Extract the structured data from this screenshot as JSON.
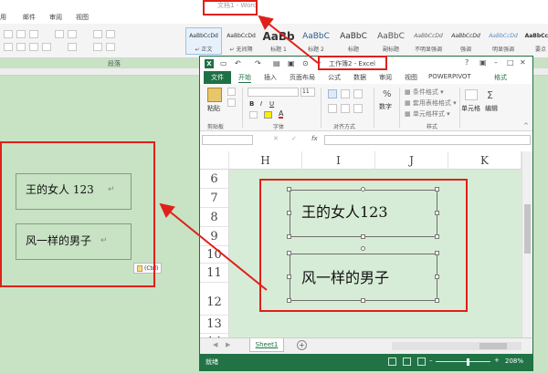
{
  "word": {
    "title": "文档1 - Word",
    "tabs": [
      "用",
      "邮件",
      "审阅",
      "视图"
    ],
    "styles": [
      {
        "sample": "AaBbCcDd",
        "name": "↵ 正文",
        "selected": true
      },
      {
        "sample": "AaBbCcDd",
        "name": "↵ 无间隔"
      },
      {
        "sample": "AaBb",
        "name": "标题 1"
      },
      {
        "sample": "AaBbC",
        "name": "标题 2"
      },
      {
        "sample": "AaBbC",
        "name": "标题"
      },
      {
        "sample": "AaBbC",
        "name": "副标题"
      },
      {
        "sample": "AaBbCcDd",
        "name": "不明显强调"
      },
      {
        "sample": "AaBbCcDd",
        "name": "强调"
      },
      {
        "sample": "AaBbCcDd",
        "name": "明显强调"
      },
      {
        "sample": "AaBbCcDd",
        "name": "要点"
      }
    ],
    "group_paragraph": "段落",
    "textbox1": "王的女人 123",
    "textbox2": "风一样的男子",
    "para_mark": "↵",
    "paste_options": "(Ctrl)"
  },
  "excel": {
    "title": "工作簿2 - Excel",
    "help": "?",
    "logo": "X",
    "tabs": {
      "file": "文件",
      "items": [
        "开始",
        "插入",
        "页面布局",
        "公式",
        "数据",
        "审阅",
        "视图",
        "POWERPIVOT",
        "格式"
      ]
    },
    "ribbon": {
      "paste": "粘贴",
      "font_size": "11",
      "number": "数字",
      "cond_format": "条件格式",
      "table_format": "套用表格格式",
      "cell_style": "单元格样式",
      "cells": "单元格",
      "edit": "编辑",
      "groups": [
        "剪贴板",
        "字体",
        "对齐方式",
        "样式"
      ]
    },
    "formula": {
      "fx": "fx",
      "cancel": "✕",
      "enter": "✓",
      "name_box": ""
    },
    "columns": [
      "H",
      "I",
      "J",
      "K"
    ],
    "rows": [
      "6",
      "7",
      "8",
      "9",
      "10",
      "11",
      "12",
      "13",
      "14"
    ],
    "shape1": "王的女人123",
    "shape2": "风一样的男子",
    "sheet_tab": "Sheet1",
    "add_sheet": "+",
    "status": "就绪",
    "zoom": "208%"
  }
}
